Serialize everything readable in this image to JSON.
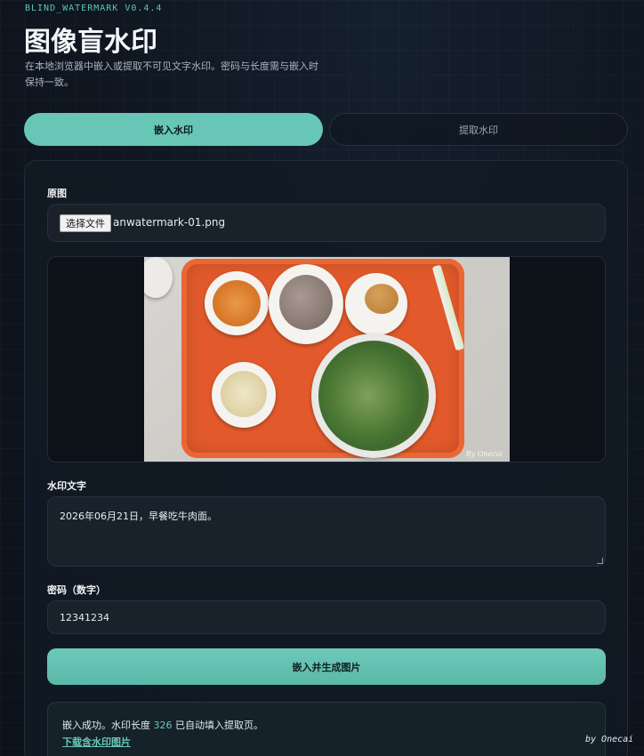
{
  "app": {
    "version": "BLIND_WATERMARK V0.4.4",
    "title": "图像盲水印",
    "subtitle": "在本地浏览器中嵌入或提取不可见文字水印。密码与长度需与嵌入时保持一致。"
  },
  "tabs": [
    {
      "label": "嵌入水印",
      "active": true
    },
    {
      "label": "提取水印",
      "active": false
    }
  ],
  "form": {
    "image_label": "原图",
    "file_button": "选择文件",
    "file_name": "anwatermark-01.png",
    "photo_signature": "By Onecai",
    "watermark_label": "水印文字",
    "watermark_value": "2026年06月21日，早餐吃牛肉面。",
    "password_label": "密码（数字）",
    "password_value": "12341234",
    "submit_label": "嵌入并生成图片"
  },
  "result": {
    "prefix": "嵌入成功。水印长度 ",
    "length": "326",
    "suffix": " 已自动填入提取页。",
    "download_label": "下载含水印图片"
  },
  "footer": {
    "byline": "by Onecai"
  },
  "colors": {
    "accent": "#68c6b7",
    "background": "#0f1620",
    "tray": "#e25a2b"
  }
}
